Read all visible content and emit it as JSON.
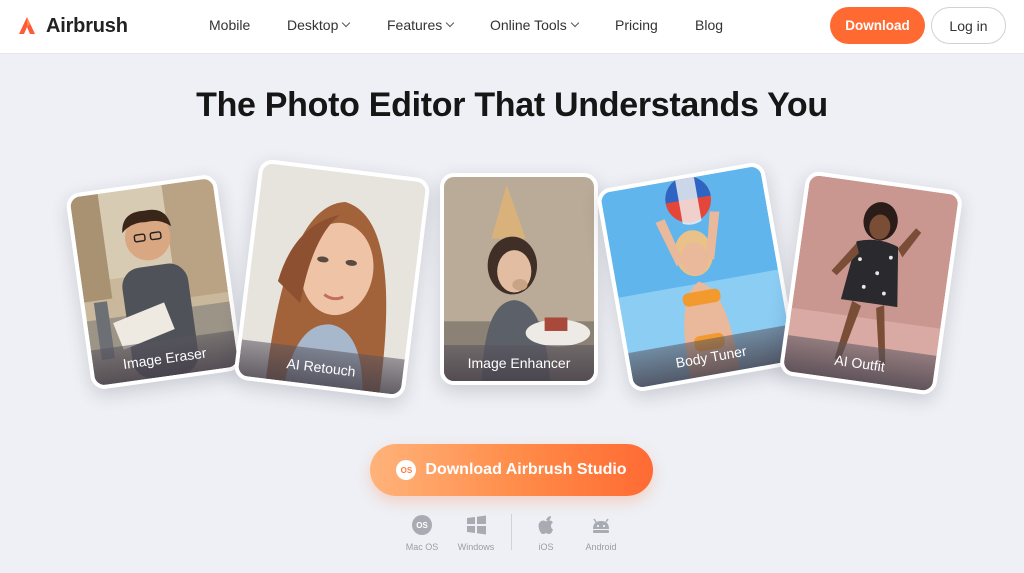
{
  "brand": {
    "name": "Airbrush",
    "accent": "#ff6a33"
  },
  "nav": {
    "items": [
      {
        "label": "Mobile",
        "dropdown": false
      },
      {
        "label": "Desktop",
        "dropdown": true
      },
      {
        "label": "Features",
        "dropdown": true
      },
      {
        "label": "Online Tools",
        "dropdown": true
      },
      {
        "label": "Pricing",
        "dropdown": false
      },
      {
        "label": "Blog",
        "dropdown": false
      }
    ],
    "download_label": "Download",
    "login_label": "Log in"
  },
  "hero": {
    "headline": "The Photo Editor That Understands You",
    "cards": [
      {
        "label": "Image Eraser"
      },
      {
        "label": "AI Retouch"
      },
      {
        "label": "Image Enhancer"
      },
      {
        "label": "Body Tuner"
      },
      {
        "label": "AI Outfit"
      }
    ]
  },
  "cta": {
    "label": "Download Airbrush Studio",
    "icon_text": "OS"
  },
  "platforms": [
    {
      "label": "Mac OS",
      "icon": "macos-icon"
    },
    {
      "label": "Windows",
      "icon": "windows-icon"
    },
    {
      "label": "iOS",
      "icon": "apple-icon"
    },
    {
      "label": "Android",
      "icon": "android-icon"
    }
  ]
}
